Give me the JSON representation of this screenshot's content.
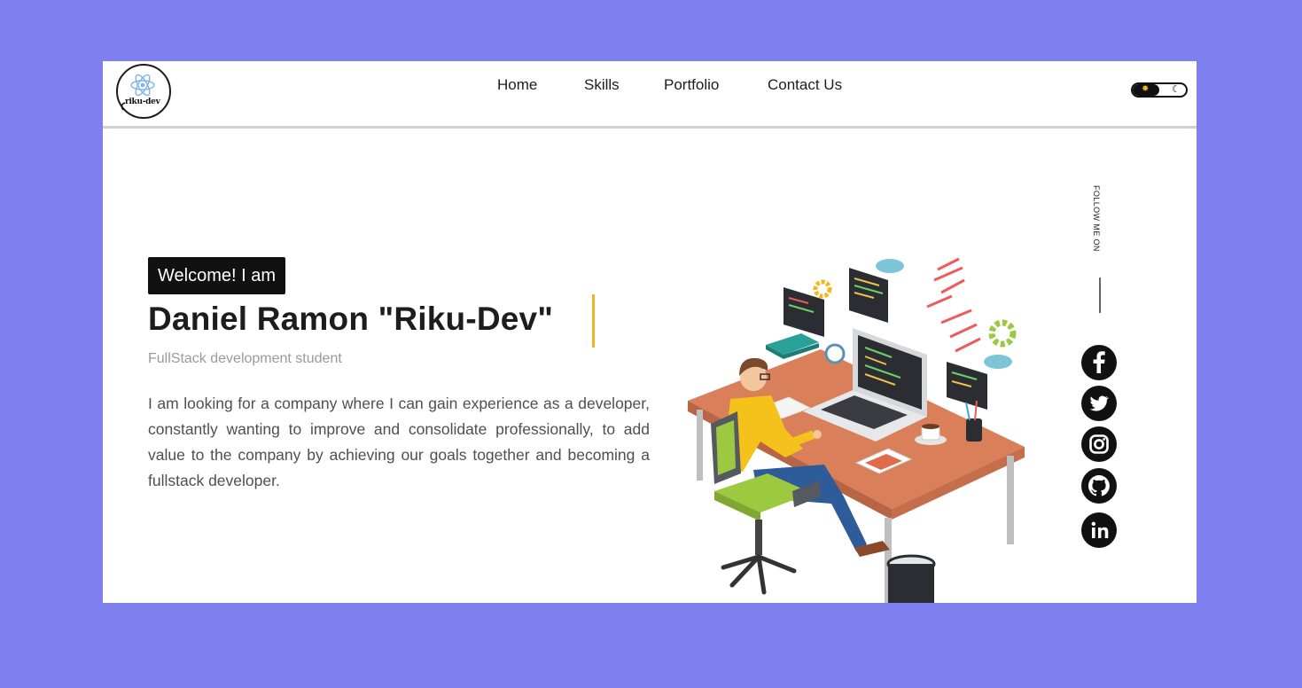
{
  "brand": {
    "logo_text": "riku-dev"
  },
  "nav": {
    "home": "Home",
    "skills": "Skills",
    "portfolio": "Portfolio",
    "contact": "Contact Us"
  },
  "theme_toggle": {
    "sun_icon": "sun-icon",
    "moon_icon": "moon-icon",
    "mode": "light"
  },
  "hero": {
    "badge": "Welcome! I am",
    "name": "Daniel Ramon \"Riku-Dev\"",
    "subtitle": "FullStack development student",
    "description": "I am looking for a company where I can gain experience as a developer, constantly wanting to improve and consolidate professionally, to add value to the company by achieving our goals together and becoming a fullstack developer."
  },
  "social": {
    "label": "FOLLOW ME ON",
    "icons": [
      "facebook-icon",
      "twitter-icon",
      "instagram-icon",
      "github-icon",
      "linkedin-icon"
    ]
  },
  "colors": {
    "background": "#7f80ef",
    "page": "#ffffff",
    "text_dark": "#1d1d1d",
    "accent_cursor": "#f0b323"
  }
}
